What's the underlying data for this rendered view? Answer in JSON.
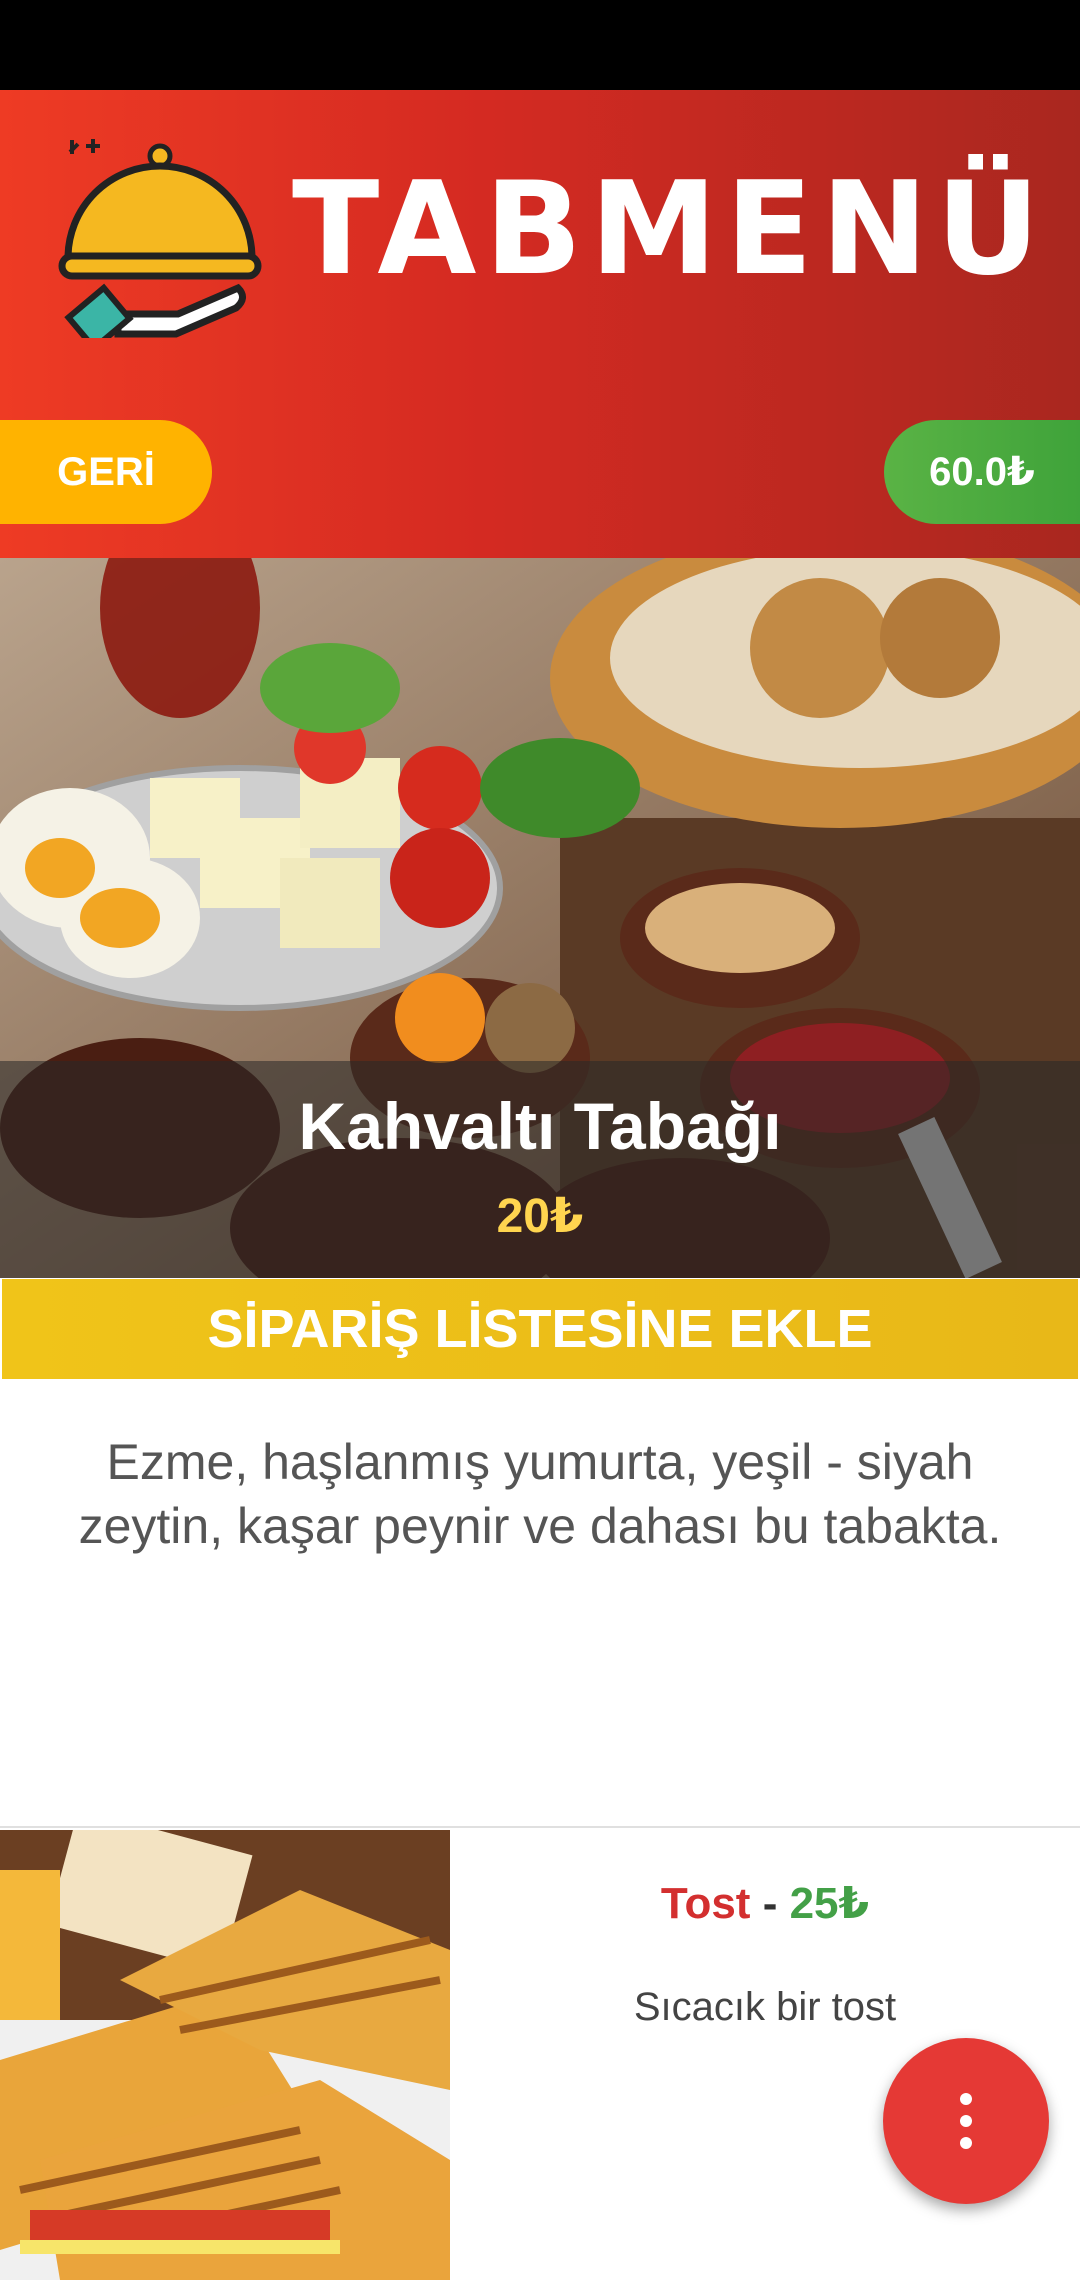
{
  "header": {
    "app_name": "TABMENÜ",
    "back_label": "GERİ",
    "cart_total": "60.0₺"
  },
  "featured": {
    "title": "Kahvaltı Tabağı",
    "price": "20₺",
    "add_to_order_label": "SİPARİŞ LİSTESİNE EKLE",
    "description": "Ezme, haşlanmış yumurta, yeşil - siyah zeytin, kaşar peynir ve dahası bu tabakta."
  },
  "list": {
    "items": [
      {
        "name": "Tost",
        "separator": " - ",
        "price": "25₺",
        "description": "Sıcacık bir tost"
      }
    ]
  },
  "icons": {
    "logo": "cloche-on-hand-icon",
    "fab": "more-vert-icon"
  },
  "colors": {
    "header_red": "#ee3b24",
    "back_yellow": "#ffb300",
    "total_green": "#4caf50",
    "add_button_yellow": "#f0c419",
    "fab_red": "#e53935"
  }
}
